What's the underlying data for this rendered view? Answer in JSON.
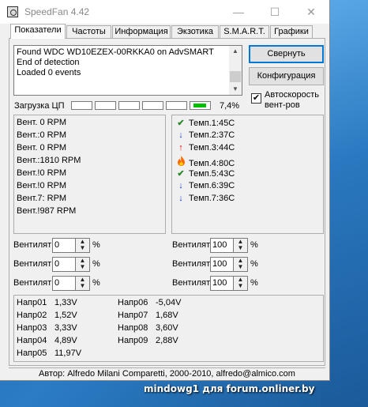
{
  "window": {
    "title": "SpeedFan 4.42",
    "min": "—",
    "max": "☐",
    "close": "✕"
  },
  "tabs": [
    {
      "label": "Показатели",
      "active": true
    },
    {
      "label": "Частоты"
    },
    {
      "label": "Информация"
    },
    {
      "label": "Экзотика"
    },
    {
      "label": "S.M.A.R.T."
    },
    {
      "label": "Графики"
    }
  ],
  "log": {
    "lines": [
      "Found WDC WD10EZEX-00RKKA0 on AdvSMART",
      "End of detection",
      "Loaded 0 events"
    ]
  },
  "buttons": {
    "minimize": "Свернуть",
    "config": "Конфигурация"
  },
  "autospeed": {
    "label": "Автоскорость вент-ров",
    "checked": true
  },
  "cpu": {
    "label": "Загрузка ЦП",
    "percent": "7,4%",
    "cells": 6,
    "filled_cell": 6
  },
  "fans": [
    "Вент. 0 RPM",
    "Вент.:0 RPM",
    "Вент. 0 RPM",
    "Вент.:1810 RPM",
    "Вент.!0 RPM",
    "Вент.!0 RPM",
    "Вент.7: RPM",
    "Вент.!987 RPM"
  ],
  "temps": [
    {
      "label": "Темп.1:45C",
      "status": "ok",
      "icon": "check-icon",
      "color": "#2a8a2a"
    },
    {
      "label": "Темп.2:37C",
      "status": "down",
      "icon": "arrow-down-icon",
      "color": "#1f3fcf"
    },
    {
      "label": "Темп.3:44C",
      "status": "up",
      "icon": "arrow-up-icon",
      "color": "#e00000"
    },
    {
      "label": "Темп.4:80C",
      "status": "fire",
      "icon": "flame-icon",
      "color": "#ff6a00"
    },
    {
      "label": "Темп.5:43C",
      "status": "ok",
      "icon": "check-icon",
      "color": "#2a8a2a"
    },
    {
      "label": "Темп.6:39C",
      "status": "down",
      "icon": "arrow-down-icon",
      "color": "#1f3fcf"
    },
    {
      "label": "Темп.7:36C",
      "status": "down",
      "icon": "arrow-down-icon",
      "color": "#1f3fcf"
    }
  ],
  "fan_controls_left": [
    {
      "label": "Вентилят",
      "value": "0",
      "unit": "%"
    },
    {
      "label": "Вентилят",
      "value": "0",
      "unit": "%"
    },
    {
      "label": "Вентилят",
      "value": "0",
      "unit": "%"
    }
  ],
  "fan_controls_right": [
    {
      "label": "Вентилят",
      "value": "100",
      "unit": "%"
    },
    {
      "label": "Вентилят",
      "value": "100",
      "unit": "%"
    },
    {
      "label": "Вентилят",
      "value": "100",
      "unit": "%"
    }
  ],
  "voltages_left": [
    {
      "name": "Напр01",
      "value": "1,33V"
    },
    {
      "name": "Напр02",
      "value": "1,52V"
    },
    {
      "name": "Напр03",
      "value": "3,33V"
    },
    {
      "name": "Напр04",
      "value": "4,89V"
    },
    {
      "name": "Напр05",
      "value": "11,97V"
    }
  ],
  "voltages_right": [
    {
      "name": "Напр06",
      "value": "-5,04V"
    },
    {
      "name": "Напр07",
      "value": "1,68V"
    },
    {
      "name": "Напр08",
      "value": "3,60V"
    },
    {
      "name": "Напр09",
      "value": "2,88V"
    }
  ],
  "status": "Автор: Alfredo Milani Comparetti, 2000-2010, alfredo@almico.com",
  "watermark": "mindowg1 для forum.onliner.by"
}
